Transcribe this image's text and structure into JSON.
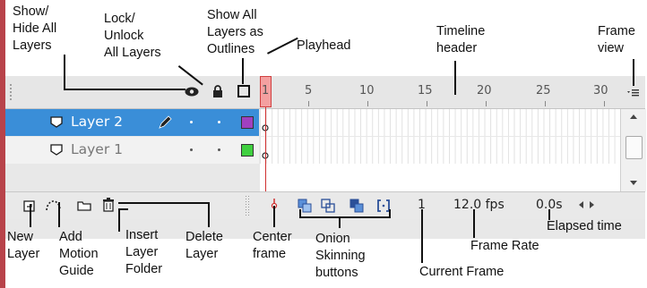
{
  "callouts": {
    "show_hide": "Show/\nHide All\nLayers",
    "lock_unlock": "Lock/\nUnlock\nAll Layers",
    "show_outlines": "Show All\nLayers as\nOutlines",
    "playhead": "Playhead",
    "timeline_header": "Timeline\nheader",
    "frame_view": "Frame\nview",
    "new_layer": "New\nLayer",
    "add_motion_guide": "Add\nMotion\nGuide",
    "insert_layer_folder": "Insert\nLayer\nFolder",
    "delete_layer": "Delete\nLayer",
    "center_frame": "Center\nframe",
    "onion_skinning": "Onion\nSkinning\nbuttons",
    "current_frame": "Current Frame",
    "frame_rate": "Frame Rate",
    "elapsed_time": "Elapsed time"
  },
  "timeline": {
    "ruler": [
      "1",
      "5",
      "10",
      "15",
      "20",
      "25",
      "30"
    ],
    "layers": [
      {
        "name": "Layer 2",
        "selected": true,
        "color": "#a040c0"
      },
      {
        "name": "Layer 1",
        "selected": false,
        "color": "#40d040"
      }
    ],
    "status": {
      "current_frame": "1",
      "frame_rate": "12.0 fps",
      "elapsed_time": "0.0s"
    }
  },
  "icons": [
    "eye-icon",
    "lock-icon",
    "outline-icon",
    "layer-type-icon",
    "pencil-icon",
    "new-layer-icon",
    "motion-guide-icon",
    "folder-icon",
    "trash-icon",
    "center-frame-icon",
    "onion-skin-icon",
    "onion-skin-outlines-icon",
    "edit-multiple-frames-icon",
    "modify-onion-markers-icon",
    "frame-view-menu-icon"
  ]
}
